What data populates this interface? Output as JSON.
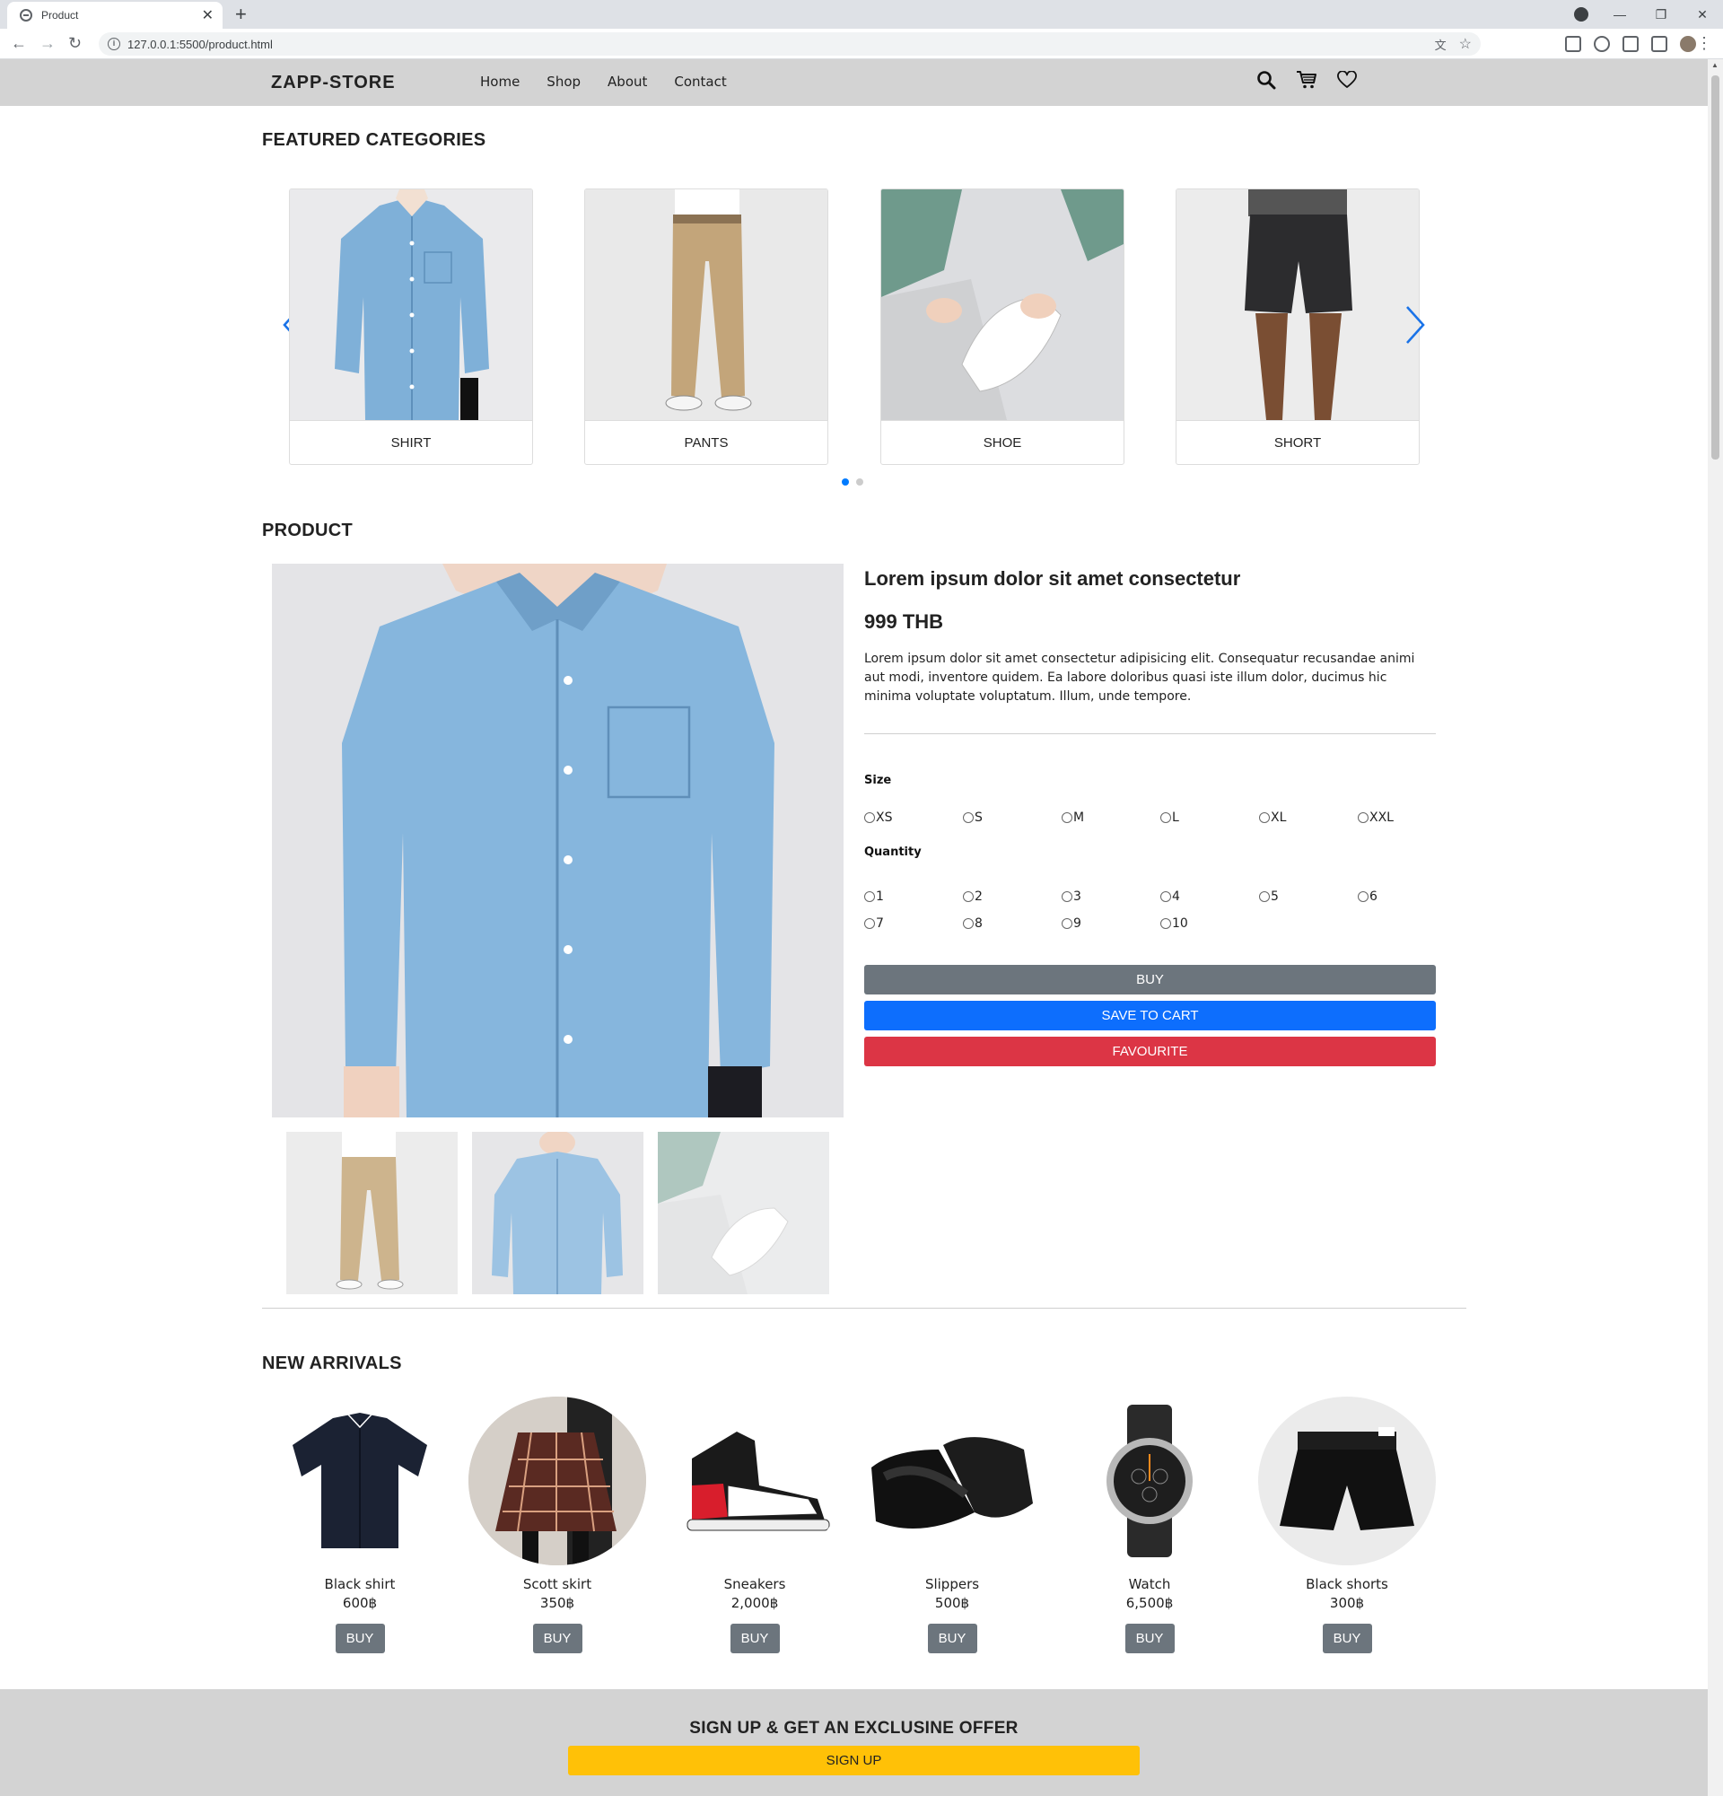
{
  "browser": {
    "tab_title": "Product",
    "url": "127.0.0.1:5500/product.html"
  },
  "navbar": {
    "brand": "ZAPP-STORE",
    "links": [
      "Home",
      "Shop",
      "About",
      "Contact"
    ],
    "icons": [
      "search-icon",
      "cart-icon",
      "heart-icon"
    ]
  },
  "featured": {
    "title": "FEATURED CATEGORIES",
    "categories": [
      "SHIRT",
      "PANTS",
      "SHOE",
      "SHORT"
    ],
    "active_slide": 1,
    "slide_count": 2
  },
  "product": {
    "section_title": "PRODUCT",
    "name": "Lorem ipsum dolor sit amet consectetur",
    "price": "999 THB",
    "description": "Lorem ipsum dolor sit amet consectetur adipisicing elit. Consequatur recusandae animi aut modi, inventore quidem. Ea labore doloribus quasi iste illum dolor, ducimus hic minima voluptate voluptatum. Illum, unde tempore.",
    "size_label": "Size",
    "sizes": [
      "XS",
      "S",
      "M",
      "L",
      "XL",
      "XXL"
    ],
    "quantity_label": "Quantity",
    "quantities": [
      "1",
      "2",
      "3",
      "4",
      "5",
      "6",
      "7",
      "8",
      "9",
      "10"
    ],
    "buy_label": "BUY",
    "cart_label": "SAVE TO CART",
    "favourite_label": "FAVOURITE",
    "colors": {
      "buy": "#6c757d",
      "cart": "#0d6efd",
      "favourite": "#dc3545"
    }
  },
  "arrivals": {
    "title": "NEW ARRIVALS",
    "items": [
      {
        "name": "Black shirt",
        "price": "600฿",
        "buy": "BUY"
      },
      {
        "name": "Scott skirt",
        "price": "350฿",
        "buy": "BUY"
      },
      {
        "name": "Sneakers",
        "price": "2,000฿",
        "buy": "BUY"
      },
      {
        "name": "Slippers",
        "price": "500฿",
        "buy": "BUY"
      },
      {
        "name": "Watch",
        "price": "6,500฿",
        "buy": "BUY"
      },
      {
        "name": "Black shorts",
        "price": "300฿",
        "buy": "BUY"
      }
    ]
  },
  "signup": {
    "title": "SIGN UP & GET AN EXCLUSINE OFFER",
    "button": "SIGN UP",
    "color": "#ffc107"
  }
}
